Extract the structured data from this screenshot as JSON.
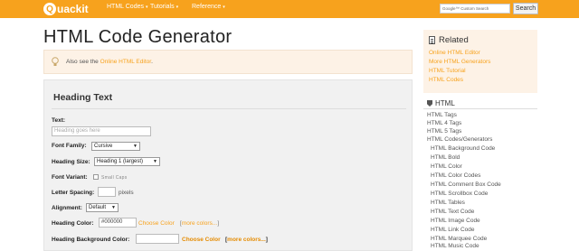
{
  "header": {
    "logo_text": "uackit",
    "logo_mark": "Q",
    "nav": [
      "HTML Codes",
      "Tutorials",
      "Reference"
    ],
    "search_placeholder": "Google™ Custom Search",
    "search_button": "Search"
  },
  "page_title": "HTML Code Generator",
  "info": {
    "prefix": "Also see the ",
    "link": "Online HTML Editor",
    "suffix": "."
  },
  "form": {
    "heading": "Heading Text",
    "text_label": "Text:",
    "text_placeholder": "Heading goes here",
    "font_family_label": "Font Family:",
    "font_family_value": "Cursive",
    "heading_size_label": "Heading Size:",
    "heading_size_value": "Heading 1 (largest)",
    "font_variant_label": "Font Variant:",
    "font_variant_option": "Small Caps",
    "letter_spacing_label": "Letter Spacing:",
    "letter_spacing_unit": "pixels",
    "alignment_label": "Alignment:",
    "alignment_value": "Default",
    "heading_color_label": "Heading Color:",
    "heading_color_value": "#000000",
    "choose_color": "Choose Color",
    "more_colors": "more colors...",
    "heading_bg_label": "Heading Background Color:"
  },
  "sidebar": {
    "related_title": "Related",
    "related_links": [
      "Online HTML Editor",
      "More HTML Generators",
      "HTML Tutorial",
      "HTML Codes"
    ],
    "html_title": "HTML",
    "html_links": [
      "HTML Tags",
      "HTML 4 Tags",
      "HTML 5 Tags",
      "HTML Codes/Generators"
    ],
    "html_sublinks": [
      "HTML Background Code",
      "HTML Bold",
      "HTML Color",
      "HTML Color Codes",
      "HTML Comment Box Code",
      "HTML Scrollbox Code",
      "HTML Tables",
      "HTML Text Code",
      "HTML Image Code",
      "HTML Link Code",
      "HTML Marquee Code",
      "HTML Music Code"
    ]
  }
}
